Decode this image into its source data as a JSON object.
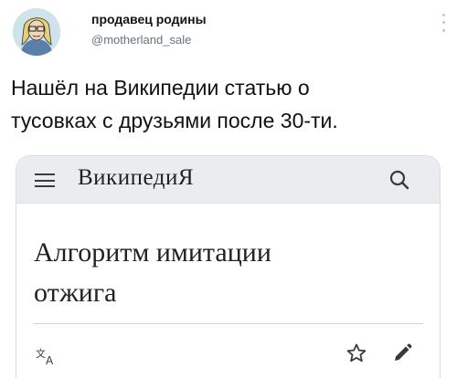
{
  "tweet": {
    "author_name": "продавец родины",
    "author_handle": "@motherland_sale",
    "text_line1": "Нашёл на Википедии статью о",
    "text_line2": "тусовках с друзьями после 30-ти."
  },
  "wiki_card": {
    "logo": "ВикипедиЯ",
    "title_line1": "Алгоритм имитации",
    "title_line2": "отжига",
    "icons": [
      "menu-icon",
      "search-icon",
      "language-icon",
      "star-icon",
      "edit-icon"
    ]
  }
}
